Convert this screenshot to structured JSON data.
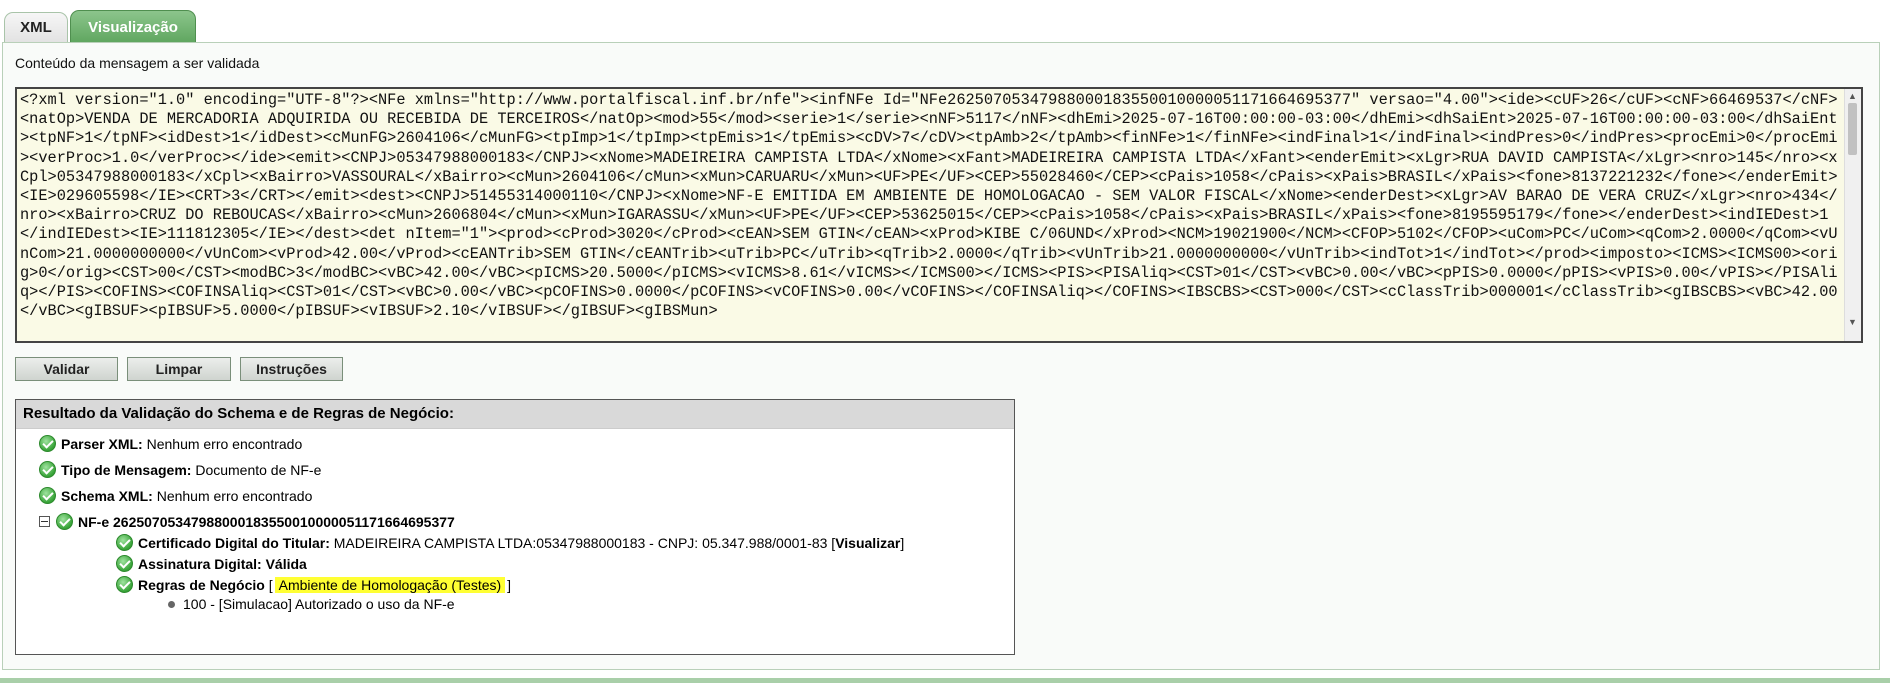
{
  "tabs": {
    "xml": "XML",
    "visualizacao": "Visualização"
  },
  "panel": {
    "label": "Conteúdo da mensagem a ser validada",
    "xml_content": "<?xml version=\"1.0\" encoding=\"UTF-8\"?><NFe xmlns=\"http://www.portalfiscal.inf.br/nfe\"><infNFe Id=\"NFe26250705347988000183550010000051171664695377\" versao=\"4.00\"><ide><cUF>26</cUF><cNF>66469537</cNF><natOp>VENDA DE MERCADORIA ADQUIRIDA OU RECEBIDA DE TERCEIROS</natOp><mod>55</mod><serie>1</serie><nNF>5117</nNF><dhEmi>2025-07-16T00:00:00-03:00</dhEmi><dhSaiEnt>2025-07-16T00:00:00-03:00</dhSaiEnt><tpNF>1</tpNF><idDest>1</idDest><cMunFG>2604106</cMunFG><tpImp>1</tpImp><tpEmis>1</tpEmis><cDV>7</cDV><tpAmb>2</tpAmb><finNFe>1</finNFe><indFinal>1</indFinal><indPres>0</indPres><procEmi>0</procEmi><verProc>1.0</verProc></ide><emit><CNPJ>05347988000183</CNPJ><xNome>MADEIREIRA CAMPISTA LTDA</xNome><xFant>MADEIREIRA CAMPISTA LTDA</xFant><enderEmit><xLgr>RUA DAVID CAMPISTA</xLgr><nro>145</nro><xCpl>05347988000183</xCpl><xBairro>VASSOURAL</xBairro><cMun>2604106</cMun><xMun>CARUARU</xMun><UF>PE</UF><CEP>55028460</CEP><cPais>1058</cPais><xPais>BRASIL</xPais><fone>8137221232</fone></enderEmit><IE>029605598</IE><CRT>3</CRT></emit><dest><CNPJ>51455314000110</CNPJ><xNome>NF-E EMITIDA EM AMBIENTE DE HOMOLOGACAO - SEM VALOR FISCAL</xNome><enderDest><xLgr>AV BARAO DE VERA CRUZ</xLgr><nro>434</nro><xBairro>CRUZ DO REBOUCAS</xBairro><cMun>2606804</cMun><xMun>IGARASSU</xMun><UF>PE</UF><CEP>53625015</CEP><cPais>1058</cPais><xPais>BRASIL</xPais><fone>8195595179</fone></enderDest><indIEDest>1</indIEDest><IE>111812305</IE></dest><det nItem=\"1\"><prod><cProd>3020</cProd><cEAN>SEM GTIN</cEAN><xProd>KIBE C/06UND</xProd><NCM>19021900</NCM><CFOP>5102</CFOP><uCom>PC</uCom><qCom>2.0000</qCom><vUnCom>21.0000000000</vUnCom><vProd>42.00</vProd><cEANTrib>SEM GTIN</cEANTrib><uTrib>PC</uTrib><qTrib>2.0000</qTrib><vUnTrib>21.0000000000</vUnTrib><indTot>1</indTot></prod><imposto><ICMS><ICMS00><orig>0</orig><CST>00</CST><modBC>3</modBC><vBC>42.00</vBC><pICMS>20.5000</pICMS><vICMS>8.61</vICMS></ICMS00></ICMS><PIS><PISAliq><CST>01</CST><vBC>0.00</vBC><pPIS>0.0000</pPIS><vPIS>0.00</vPIS></PISAliq></PIS><COFINS><COFINSAliq><CST>01</CST><vBC>0.00</vBC><pCOFINS>0.0000</pCOFINS><vCOFINS>0.00</vCOFINS></COFINSAliq></COFINS><IBSCBS><CST>000</CST><cClassTrib>000001</cClassTrib><gIBSCBS><vBC>42.00</vBC><gIBSUF><pIBSUF>5.0000</pIBSUF><vIBSUF>2.10</vIBSUF></gIBSUF><gIBSMun>"
  },
  "buttons": {
    "validar": "Validar",
    "limpar": "Limpar",
    "instrucoes": "Instruções"
  },
  "result": {
    "title": "Resultado da Validação do Schema e de Regras de Negócio:",
    "parser": {
      "label": "Parser XML:",
      "value": "Nenhum erro encontrado"
    },
    "tipo": {
      "label": "Tipo de Mensagem:",
      "value": "Documento de NF-e"
    },
    "schema": {
      "label": "Schema XML:",
      "value": "Nenhum erro encontrado"
    },
    "nfe": {
      "label": "NF-e 26250705347988000183550010000051171664695377"
    },
    "certificado": {
      "label": "Certificado Digital do Titular:",
      "value": "MADEIREIRA CAMPISTA LTDA:05347988000183 - CNPJ: 05.347.988/0001-83 [",
      "link": "Visualizar",
      "suffix": "]"
    },
    "assinatura": {
      "label": "Assinatura Digital: Válida"
    },
    "regras": {
      "label": "Regras de Negócio",
      "open": "[",
      "ambiente": "Ambiente de Homologação (Testes)",
      "close": "]"
    },
    "status": "100 - [Simulacao] Autorizado o uso da NF-e"
  },
  "colors": {
    "active_tab": "#5fa65f",
    "xml_background": "#fafae6",
    "highlight": "#ffff33",
    "check": "#37a337"
  }
}
